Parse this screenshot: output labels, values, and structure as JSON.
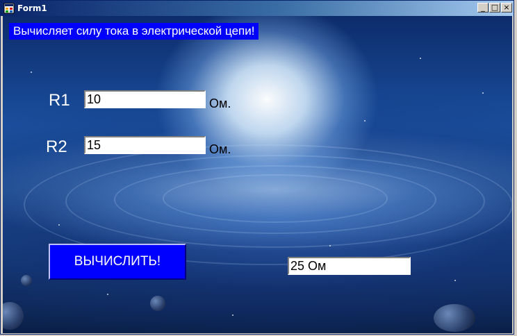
{
  "window": {
    "title": "Form1",
    "controls": {
      "minimize": "_",
      "maximize": "□",
      "close": "×"
    },
    "icon": "form-app-icon"
  },
  "form": {
    "banner": "Вычисляет силу тока в электрической цепи!",
    "r1": {
      "label": "R1",
      "value": "10",
      "unit": "Ом."
    },
    "r2": {
      "label": "R2",
      "value": "15",
      "unit": "Ом."
    },
    "calculate_button": "ВЫЧИСЛИТЬ!",
    "result": "25 Ом"
  }
}
